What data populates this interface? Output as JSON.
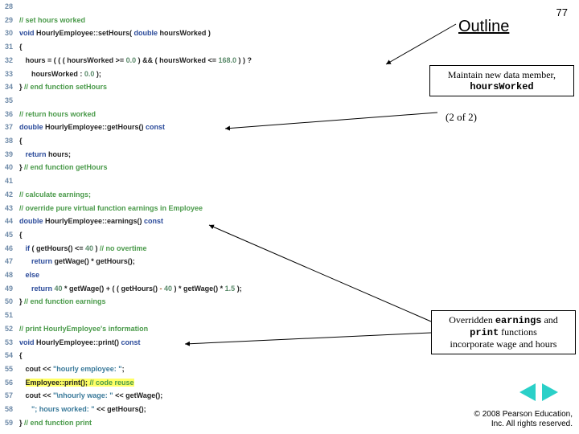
{
  "slide_number": "77",
  "outline_label": "Outline",
  "page_part": "(2 of 2)",
  "callout1": {
    "line1": "Maintain new data member,",
    "line2_mono": "hoursWorked"
  },
  "callout2": {
    "line1_pre": "Overridden ",
    "line1_mono1": "earnings",
    "line1_mid": " and ",
    "line2_mono": "print",
    "line2_post": " functions",
    "line3": "incorporate wage and hours"
  },
  "copyright": {
    "line1": "© 2008 Pearson Education,",
    "line2": "Inc.  All rights reserved."
  },
  "nav": {
    "prev": "previous-slide",
    "next": "next-slide"
  },
  "code": [
    {
      "n": "28"
    },
    {
      "n": "29",
      "seg": [
        {
          "c": "cmt",
          "t": "// set hours worked"
        }
      ]
    },
    {
      "n": "30",
      "seg": [
        {
          "c": "kw",
          "t": "void "
        },
        {
          "c": "plain",
          "t": "HourlyEmployee::setHours( "
        },
        {
          "c": "kw",
          "t": "double "
        },
        {
          "c": "plain",
          "t": "hoursWorked )"
        }
      ]
    },
    {
      "n": "31",
      "seg": [
        {
          "c": "plain",
          "t": "{"
        }
      ]
    },
    {
      "n": "32",
      "seg": [
        {
          "c": "plain",
          "t": "   hours = ( ( ( hoursWorked >= "
        },
        {
          "c": "num",
          "t": "0.0"
        },
        {
          "c": "plain",
          "t": " ) && ( hoursWorked <= "
        },
        {
          "c": "num",
          "t": "168.0"
        },
        {
          "c": "plain",
          "t": " ) ) ?"
        }
      ]
    },
    {
      "n": "33",
      "seg": [
        {
          "c": "plain",
          "t": "      hoursWorked : "
        },
        {
          "c": "num",
          "t": "0.0"
        },
        {
          "c": "plain",
          "t": " );"
        }
      ]
    },
    {
      "n": "34",
      "seg": [
        {
          "c": "plain",
          "t": "} "
        },
        {
          "c": "cmt",
          "t": "// end function setHours"
        }
      ]
    },
    {
      "n": "35"
    },
    {
      "n": "36",
      "seg": [
        {
          "c": "cmt",
          "t": "// return hours worked"
        }
      ]
    },
    {
      "n": "37",
      "seg": [
        {
          "c": "kw",
          "t": "double "
        },
        {
          "c": "plain",
          "t": "HourlyEmployee::getHours() "
        },
        {
          "c": "kw",
          "t": "const"
        }
      ]
    },
    {
      "n": "38",
      "seg": [
        {
          "c": "plain",
          "t": "{"
        }
      ]
    },
    {
      "n": "39",
      "seg": [
        {
          "c": "plain",
          "t": "   "
        },
        {
          "c": "kw",
          "t": "return "
        },
        {
          "c": "plain",
          "t": "hours;"
        }
      ]
    },
    {
      "n": "40",
      "seg": [
        {
          "c": "plain",
          "t": "} "
        },
        {
          "c": "cmt",
          "t": "// end function getHours"
        }
      ]
    },
    {
      "n": "41"
    },
    {
      "n": "42",
      "seg": [
        {
          "c": "cmt",
          "t": "// calculate earnings;"
        }
      ]
    },
    {
      "n": "43",
      "seg": [
        {
          "c": "cmt",
          "t": "// override pure virtual function earnings in Employee"
        }
      ]
    },
    {
      "n": "44",
      "seg": [
        {
          "c": "kw",
          "t": "double "
        },
        {
          "c": "plain",
          "t": "HourlyEmployee::earnings() "
        },
        {
          "c": "kw",
          "t": "const"
        }
      ]
    },
    {
      "n": "45",
      "seg": [
        {
          "c": "plain",
          "t": "{"
        }
      ]
    },
    {
      "n": "46",
      "seg": [
        {
          "c": "plain",
          "t": "   "
        },
        {
          "c": "kw",
          "t": "if "
        },
        {
          "c": "plain",
          "t": "( getHours() <= "
        },
        {
          "c": "num",
          "t": "40"
        },
        {
          "c": "plain",
          "t": " ) "
        },
        {
          "c": "cmt",
          "t": "// no overtime"
        }
      ]
    },
    {
      "n": "47",
      "seg": [
        {
          "c": "plain",
          "t": "      "
        },
        {
          "c": "kw",
          "t": "return "
        },
        {
          "c": "plain",
          "t": "getWage() * getHours();"
        }
      ]
    },
    {
      "n": "48",
      "seg": [
        {
          "c": "plain",
          "t": "   "
        },
        {
          "c": "kw",
          "t": "else"
        }
      ]
    },
    {
      "n": "49",
      "seg": [
        {
          "c": "plain",
          "t": "      "
        },
        {
          "c": "kw",
          "t": "return "
        },
        {
          "c": "num",
          "t": "40"
        },
        {
          "c": "plain",
          "t": " * getWage() + ( ( getHours() "
        },
        {
          "c": "op",
          "t": "-"
        },
        {
          "c": "plain",
          "t": " "
        },
        {
          "c": "num",
          "t": "40"
        },
        {
          "c": "plain",
          "t": " ) * getWage() * "
        },
        {
          "c": "num",
          "t": "1.5"
        },
        {
          "c": "plain",
          "t": " );"
        }
      ]
    },
    {
      "n": "50",
      "seg": [
        {
          "c": "plain",
          "t": "} "
        },
        {
          "c": "cmt",
          "t": "// end function earnings"
        }
      ]
    },
    {
      "n": "51"
    },
    {
      "n": "52",
      "seg": [
        {
          "c": "cmt",
          "t": "// print HourlyEmployee's information"
        }
      ]
    },
    {
      "n": "53",
      "seg": [
        {
          "c": "kw",
          "t": "void "
        },
        {
          "c": "plain",
          "t": "HourlyEmployee::print() "
        },
        {
          "c": "kw",
          "t": "const"
        }
      ]
    },
    {
      "n": "54",
      "seg": [
        {
          "c": "plain",
          "t": "{"
        }
      ]
    },
    {
      "n": "55",
      "seg": [
        {
          "c": "plain",
          "t": "   cout << "
        },
        {
          "c": "str",
          "t": "\"hourly employee: \""
        },
        {
          "c": "plain",
          "t": ";"
        }
      ]
    },
    {
      "n": "56",
      "seg": [
        {
          "c": "plain",
          "t": "   "
        },
        {
          "c": "hl plain",
          "t": "Employee::print(); "
        },
        {
          "c": "hl cmt",
          "t": "// code reuse"
        }
      ]
    },
    {
      "n": "57",
      "seg": [
        {
          "c": "plain",
          "t": "   cout << "
        },
        {
          "c": "str",
          "t": "\"\\nhourly wage: \""
        },
        {
          "c": "plain",
          "t": " << getWage();"
        }
      ]
    },
    {
      "n": "58",
      "seg": [
        {
          "c": "plain",
          "t": "      "
        },
        {
          "c": "str",
          "t": "\"; hours worked: \""
        },
        {
          "c": "plain",
          "t": " << getHours();"
        }
      ]
    },
    {
      "n": "59",
      "seg": [
        {
          "c": "plain",
          "t": "} "
        },
        {
          "c": "cmt",
          "t": "// end function print"
        }
      ]
    }
  ]
}
